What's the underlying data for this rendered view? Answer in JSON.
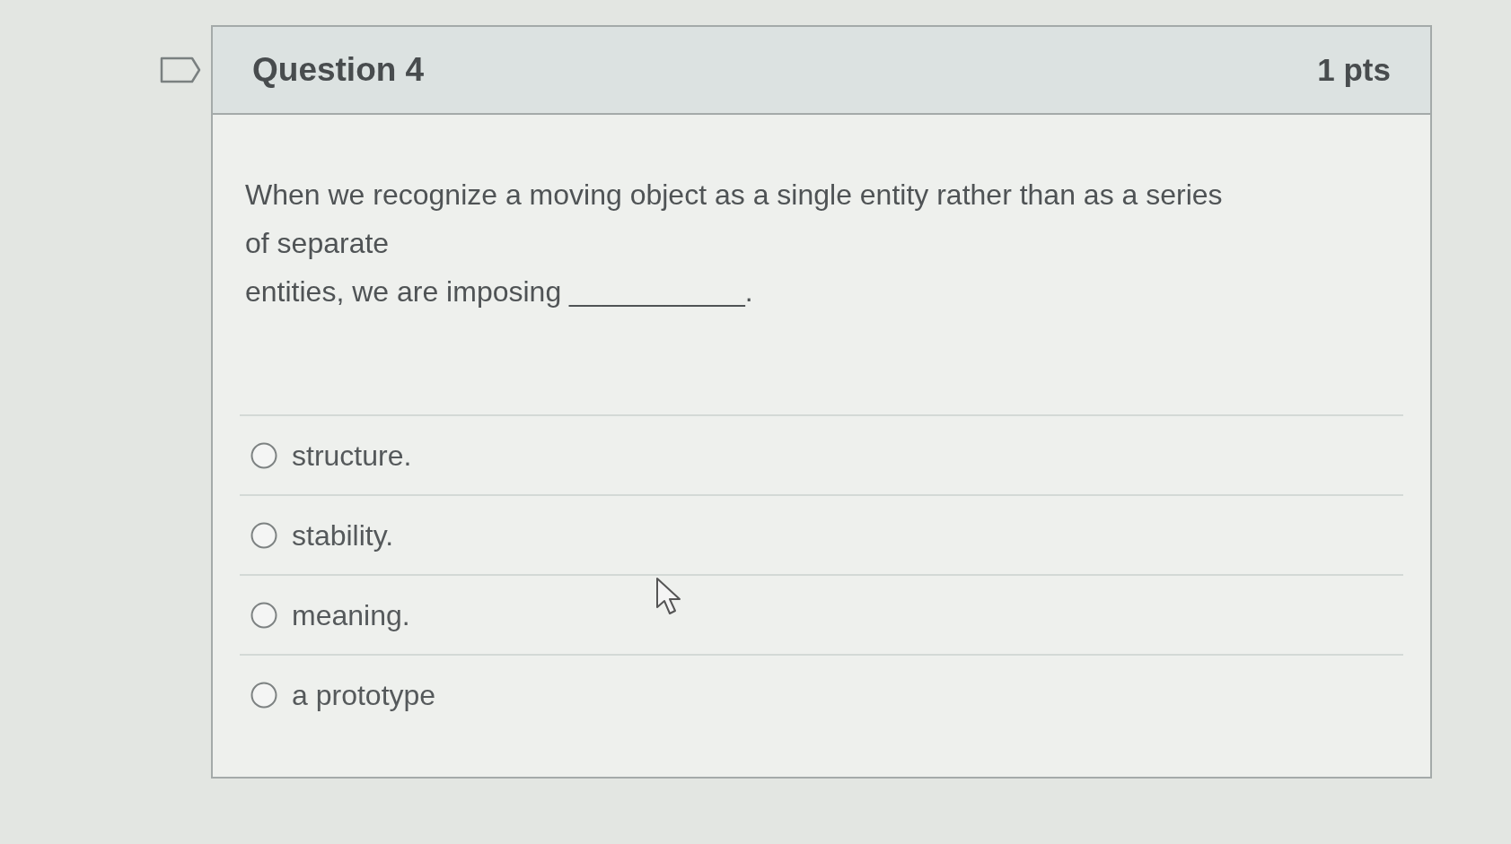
{
  "question": {
    "title": "Question 4",
    "points": "1 pts",
    "prompt_lines": [
      "When we recognize a moving object as a single entity rather than as a series",
      "of separate",
      "entities, we are imposing ___________."
    ],
    "options": [
      {
        "label": "structure.",
        "selected": false
      },
      {
        "label": "stability.",
        "selected": false
      },
      {
        "label": "meaning.",
        "selected": false
      },
      {
        "label": "a prototype",
        "selected": false
      }
    ]
  }
}
